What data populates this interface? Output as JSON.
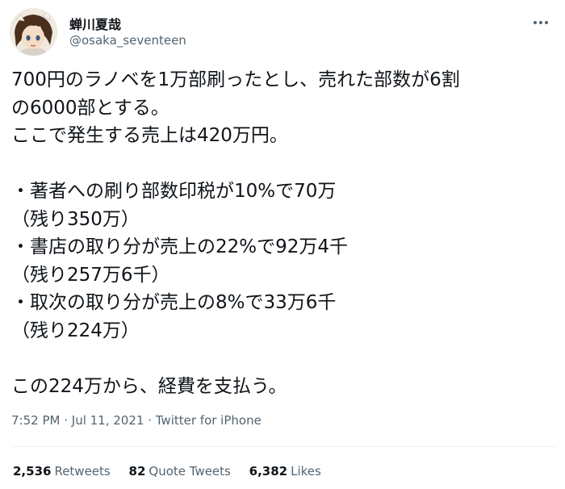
{
  "author": {
    "display_name": "蝉川夏哉",
    "handle": "@osaka_seventeen"
  },
  "tweet": {
    "lines": [
      "700円のラノベを1万部刷ったとし、売れた部数が6割",
      "の6000部とする。",
      "ここで発生する売上は420万円。",
      "",
      "・著者への刷り部数印税が10%で70万",
      "（残り350万）",
      "・書店の取り分が売上の22%で92万4千",
      "（残り257万6千）",
      "・取次の取り分が売上の8%で33万6千",
      "（残り224万）",
      "",
      "この224万から、経費を支払う。"
    ]
  },
  "meta": {
    "time": "7:52 PM",
    "separator": " · ",
    "date": "Jul 11, 2021",
    "source": "Twitter for iPhone"
  },
  "stats": {
    "retweets_count": "2,536",
    "retweets_label": "Retweets",
    "quotes_count": "82",
    "quotes_label": "Quote Tweets",
    "likes_count": "6,382",
    "likes_label": "Likes"
  },
  "icons": {
    "more": "more-horizontal-icon",
    "avatar": "avatar-illustration"
  },
  "colors": {
    "text_primary": "#0f1419",
    "text_secondary": "#536471",
    "divider": "#eff3f4"
  }
}
